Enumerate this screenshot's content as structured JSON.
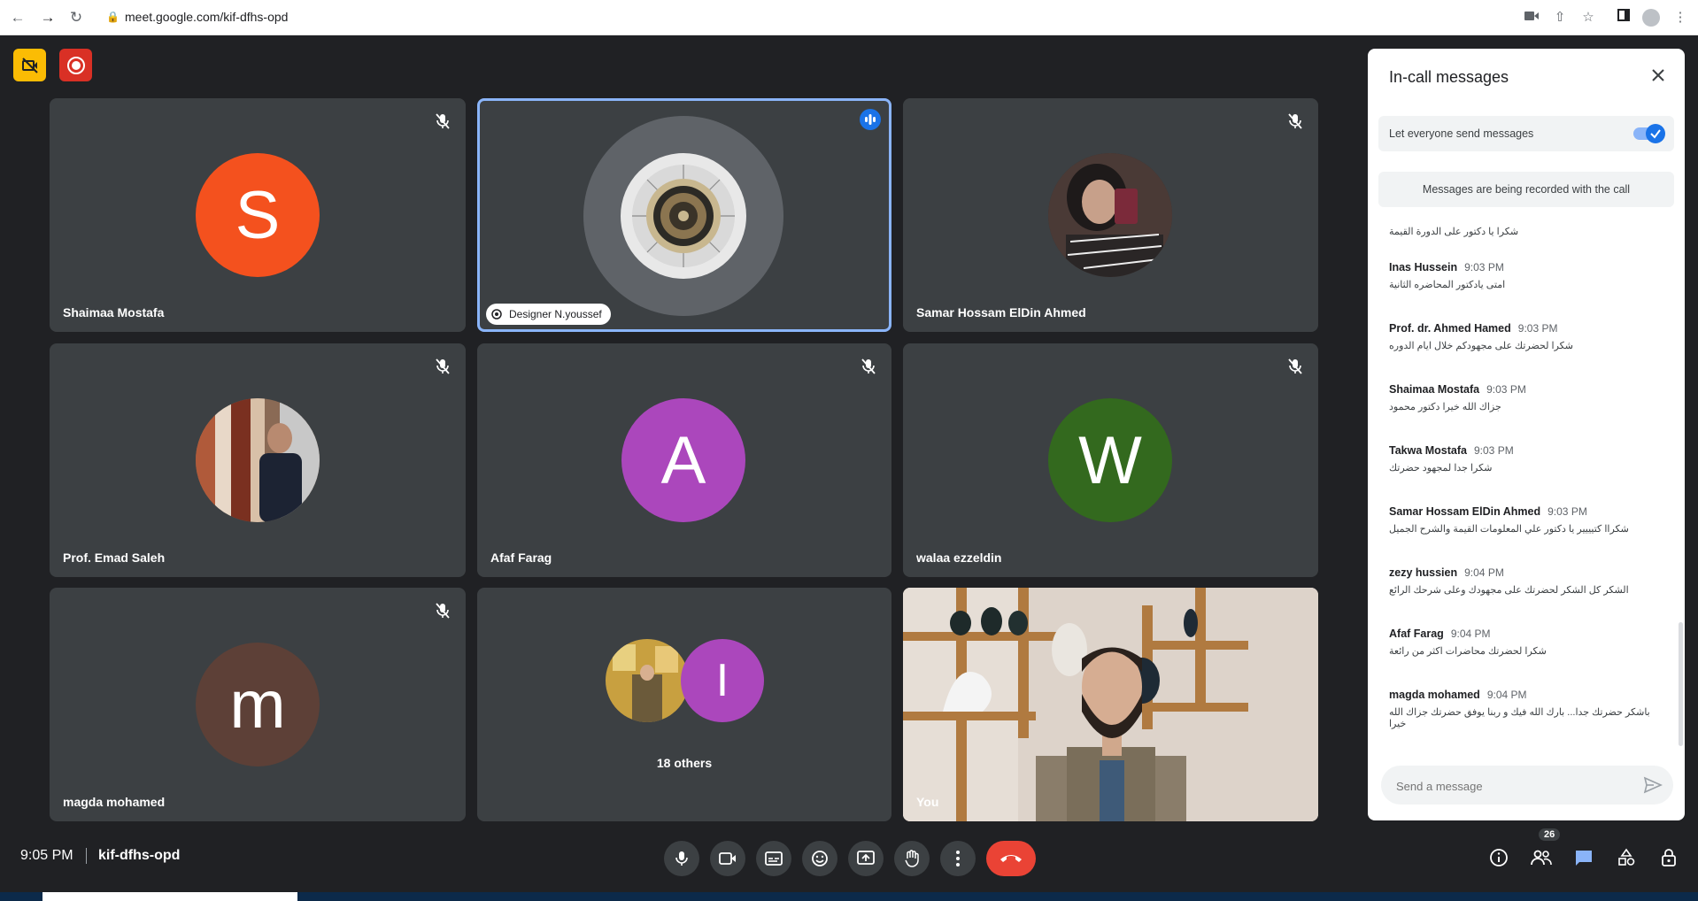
{
  "browser": {
    "url": "meet.google.com/kif-dfhs-opd"
  },
  "tiles": [
    {
      "name": "Shaimaa Mostafa",
      "initial": "S",
      "color": "#f4511e"
    },
    {
      "name": "Designer N.youssef"
    },
    {
      "name": "Samar Hossam ElDin Ahmed"
    },
    {
      "name": "Prof. Emad Saleh"
    },
    {
      "name": "Afaf Farag",
      "initial": "A",
      "color": "#ab47bc"
    },
    {
      "name": "walaa ezzeldin",
      "initial": "W",
      "color": "#33691e"
    },
    {
      "name": "magda mohamed",
      "initial": "m",
      "color": "#5d4037"
    },
    {
      "name": "18 others",
      "initial": "I",
      "color": "#ab47bc"
    },
    {
      "name": "You"
    }
  ],
  "chat": {
    "title": "In-call messages",
    "toggle_label": "Let everyone send messages",
    "toggle_on": true,
    "recorded_notice": "Messages are being recorded with the call",
    "messages": [
      {
        "sender": "",
        "time": "",
        "text": "شكرا يا دكتور على الدورة القيمة"
      },
      {
        "sender": "Inas Hussein",
        "time": "9:03 PM",
        "text": "امتى يادكتور المحاضره الثانية"
      },
      {
        "sender": "Prof. dr. Ahmed Hamed",
        "time": "9:03 PM",
        "text": "شكرا لحضرتك على مجهودكم خلال ايام الدوره"
      },
      {
        "sender": "Shaimaa Mostafa",
        "time": "9:03 PM",
        "text": "جزاك الله خيرا دكتور محمود"
      },
      {
        "sender": "Takwa Mostafa",
        "time": "9:03 PM",
        "text": "شكرا جدا لمجهود حضرتك"
      },
      {
        "sender": "Samar Hossam ElDin Ahmed",
        "time": "9:03 PM",
        "text": "شكراا كتيييير يا دكتور علي المعلومات القيمة والشرح الجميل"
      },
      {
        "sender": "zezy hussien",
        "time": "9:04 PM",
        "text": "الشكر كل الشكر لحضرتك على مجهودك وعلى شرحك الرائع"
      },
      {
        "sender": "Afaf Farag",
        "time": "9:04 PM",
        "text": "شكرا لحضرتك محاضرات اكثر من رائعة"
      },
      {
        "sender": "magda mohamed",
        "time": "9:04 PM",
        "text": "باشكر حضرتك جدا... بارك الله فيك و ربنا يوفق حضرتك جزاك الله خيرا"
      }
    ],
    "send_placeholder": "Send a message"
  },
  "bottom": {
    "time": "9:05 PM",
    "meeting_code": "kif-dfhs-opd",
    "people_count": "26"
  },
  "colors": {
    "background": "#202124",
    "tile": "#3c4043",
    "accent": "#1a73e8",
    "hangup": "#ea4335",
    "record": "#d93025",
    "warning": "#fbbc04"
  },
  "icons": {
    "top": [
      "camera-off-icon",
      "record-icon"
    ],
    "controls": [
      "mic-icon",
      "camera-icon",
      "captions-icon",
      "emoji-icon",
      "present-icon",
      "raise-hand-icon",
      "more-options-icon",
      "hangup-icon"
    ],
    "right": [
      "info-icon",
      "people-icon",
      "chat-icon",
      "activities-icon",
      "host-controls-icon"
    ]
  }
}
